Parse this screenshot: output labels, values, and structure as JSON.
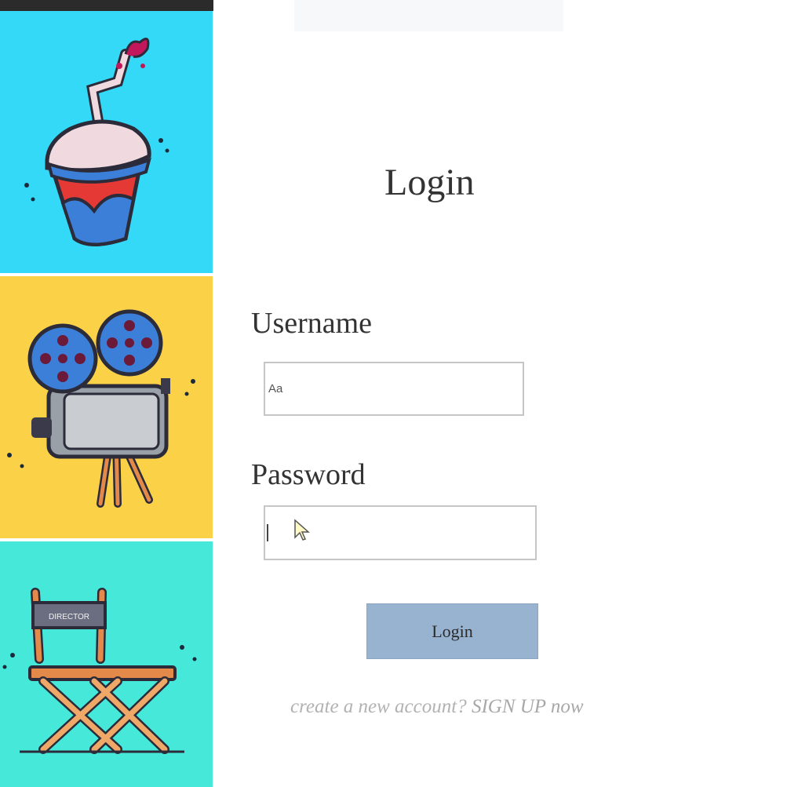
{
  "login": {
    "title": "Login",
    "username_label": "Username",
    "username_placeholder": "Aa",
    "password_label": "Password",
    "submit_label": "Login",
    "signup_prompt": "create a new account?",
    "signup_link": "SIGN UP now"
  },
  "sidebar": {
    "panels": [
      {
        "name": "soda-cup",
        "color": "#33d9f7"
      },
      {
        "name": "movie-camera",
        "color": "#fbd247"
      },
      {
        "name": "director-chair",
        "color": "#46e8d9",
        "chair_text": "DIRECTOR"
      }
    ]
  }
}
